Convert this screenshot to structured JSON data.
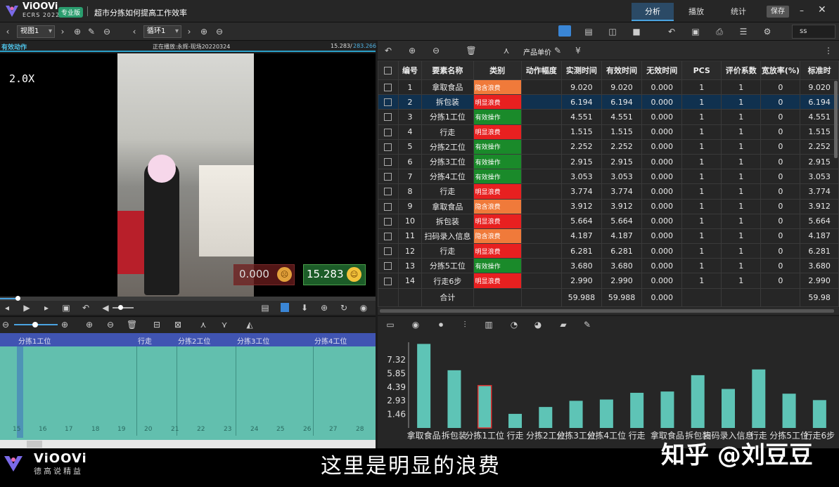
{
  "app": {
    "brand": "ViOOVi",
    "edition": "ECRS 2022",
    "badge": "专业版",
    "title": "超市分拣如何提高工作效率"
  },
  "top_tabs": [
    "分析",
    "播放",
    "统计"
  ],
  "save_label": "保存",
  "window": {
    "minimize": "–",
    "close": "✕"
  },
  "toolbar": {
    "view_select": "视图1",
    "loop_select": "循环1",
    "search_value": "ss"
  },
  "video": {
    "panel_label": "有效动作",
    "playing_label": "正在播放:永辉-现场20220324",
    "time_current": "15.283/",
    "time_total": "283.266",
    "speed": "2.0X",
    "badge_red": "0.000",
    "badge_green": "15.283",
    "progress_fraction": 0.05
  },
  "timeline": {
    "segments": [
      "分拣1工位",
      "行走",
      "分拣2工位",
      "分拣3工位",
      "分拣4工位"
    ],
    "ticks": [
      "15",
      "16",
      "17",
      "18",
      "19",
      "20",
      "21",
      "22",
      "23",
      "24",
      "25",
      "26",
      "27",
      "28"
    ]
  },
  "right_toolbar": {
    "unit_price_label": "产品单价"
  },
  "table": {
    "headers": [
      "编号",
      "要素名称",
      "类别",
      "动作幅度",
      "实测时间",
      "有效时间",
      "无效时间",
      "PCS",
      "评价系数",
      "宽放率(%)",
      "标准时"
    ],
    "rows": [
      {
        "no": "1",
        "name": "拿取食品",
        "cat": "隐含浪费",
        "ctype": "hidden",
        "meas": "9.020",
        "eff": "9.020",
        "ineff": "0.000",
        "pcs": "1",
        "coef": "1",
        "allow": "0",
        "std": "9.020"
      },
      {
        "no": "2",
        "name": "拆包装",
        "cat": "明显浪费",
        "ctype": "obvious",
        "meas": "6.194",
        "eff": "6.194",
        "ineff": "0.000",
        "pcs": "1",
        "coef": "1",
        "allow": "0",
        "std": "6.194"
      },
      {
        "no": "3",
        "name": "分拣1工位",
        "cat": "有效操作",
        "ctype": "valid",
        "meas": "4.551",
        "eff": "4.551",
        "ineff": "0.000",
        "pcs": "1",
        "coef": "1",
        "allow": "0",
        "std": "4.551"
      },
      {
        "no": "4",
        "name": "行走",
        "cat": "明显浪费",
        "ctype": "obvious",
        "meas": "1.515",
        "eff": "1.515",
        "ineff": "0.000",
        "pcs": "1",
        "coef": "1",
        "allow": "0",
        "std": "1.515"
      },
      {
        "no": "5",
        "name": "分拣2工位",
        "cat": "有效操作",
        "ctype": "valid",
        "meas": "2.252",
        "eff": "2.252",
        "ineff": "0.000",
        "pcs": "1",
        "coef": "1",
        "allow": "0",
        "std": "2.252"
      },
      {
        "no": "6",
        "name": "分拣3工位",
        "cat": "有效操作",
        "ctype": "valid",
        "meas": "2.915",
        "eff": "2.915",
        "ineff": "0.000",
        "pcs": "1",
        "coef": "1",
        "allow": "0",
        "std": "2.915"
      },
      {
        "no": "7",
        "name": "分拣4工位",
        "cat": "有效操作",
        "ctype": "valid",
        "meas": "3.053",
        "eff": "3.053",
        "ineff": "0.000",
        "pcs": "1",
        "coef": "1",
        "allow": "0",
        "std": "3.053"
      },
      {
        "no": "8",
        "name": "行走",
        "cat": "明显浪费",
        "ctype": "obvious",
        "meas": "3.774",
        "eff": "3.774",
        "ineff": "0.000",
        "pcs": "1",
        "coef": "1",
        "allow": "0",
        "std": "3.774"
      },
      {
        "no": "9",
        "name": "拿取食品",
        "cat": "隐含浪费",
        "ctype": "hidden",
        "meas": "3.912",
        "eff": "3.912",
        "ineff": "0.000",
        "pcs": "1",
        "coef": "1",
        "allow": "0",
        "std": "3.912"
      },
      {
        "no": "10",
        "name": "拆包装",
        "cat": "明显浪费",
        "ctype": "obvious",
        "meas": "5.664",
        "eff": "5.664",
        "ineff": "0.000",
        "pcs": "1",
        "coef": "1",
        "allow": "0",
        "std": "5.664"
      },
      {
        "no": "11",
        "name": "扫码录入信息",
        "cat": "隐含浪费",
        "ctype": "hidden",
        "meas": "4.187",
        "eff": "4.187",
        "ineff": "0.000",
        "pcs": "1",
        "coef": "1",
        "allow": "0",
        "std": "4.187"
      },
      {
        "no": "12",
        "name": "行走",
        "cat": "明显浪费",
        "ctype": "obvious",
        "meas": "6.281",
        "eff": "6.281",
        "ineff": "0.000",
        "pcs": "1",
        "coef": "1",
        "allow": "0",
        "std": "6.281"
      },
      {
        "no": "13",
        "name": "分拣5工位",
        "cat": "有效操作",
        "ctype": "valid",
        "meas": "3.680",
        "eff": "3.680",
        "ineff": "0.000",
        "pcs": "1",
        "coef": "1",
        "allow": "0",
        "std": "3.680"
      },
      {
        "no": "14",
        "name": "行走6步",
        "cat": "明显浪费",
        "ctype": "obvious",
        "meas": "2.990",
        "eff": "2.990",
        "ineff": "0.000",
        "pcs": "1",
        "coef": "1",
        "allow": "0",
        "std": "2.990"
      }
    ],
    "total": {
      "label": "合计",
      "meas": "59.988",
      "eff": "59.988",
      "ineff": "0.000",
      "std": "59.98"
    },
    "selected_row": 1
  },
  "colors": {
    "hidden": "#f07a3a",
    "obvious": "#e82020",
    "valid": "#1a8a2a",
    "bar": "#5ec4b6",
    "bar_selected_border": "#e03030",
    "accent": "#4aa3e0"
  },
  "chart_data": {
    "type": "bar",
    "categories": [
      "拿取食品",
      "拆包装",
      "分拣1工位",
      "行走",
      "分拣2工位",
      "分拣3工位",
      "分拣4工位",
      "行走",
      "拿取食品",
      "拆包装",
      "扫码录入信息",
      "行走",
      "分拣5工位",
      "行走6步"
    ],
    "values": [
      9.02,
      6.194,
      4.551,
      1.515,
      2.252,
      2.915,
      3.053,
      3.774,
      3.912,
      5.664,
      4.187,
      6.281,
      3.68,
      2.99
    ],
    "yticks": [
      "1.46",
      "2.93",
      "4.39",
      "5.85",
      "7.32"
    ],
    "selected_index": 2,
    "ylim": [
      0,
      9.2
    ]
  },
  "footer": {
    "brand": "ViOOVi",
    "slogan": "德高说精益",
    "subtitle": "这里是明显的浪费",
    "watermark": "知乎 @刘豆豆"
  }
}
